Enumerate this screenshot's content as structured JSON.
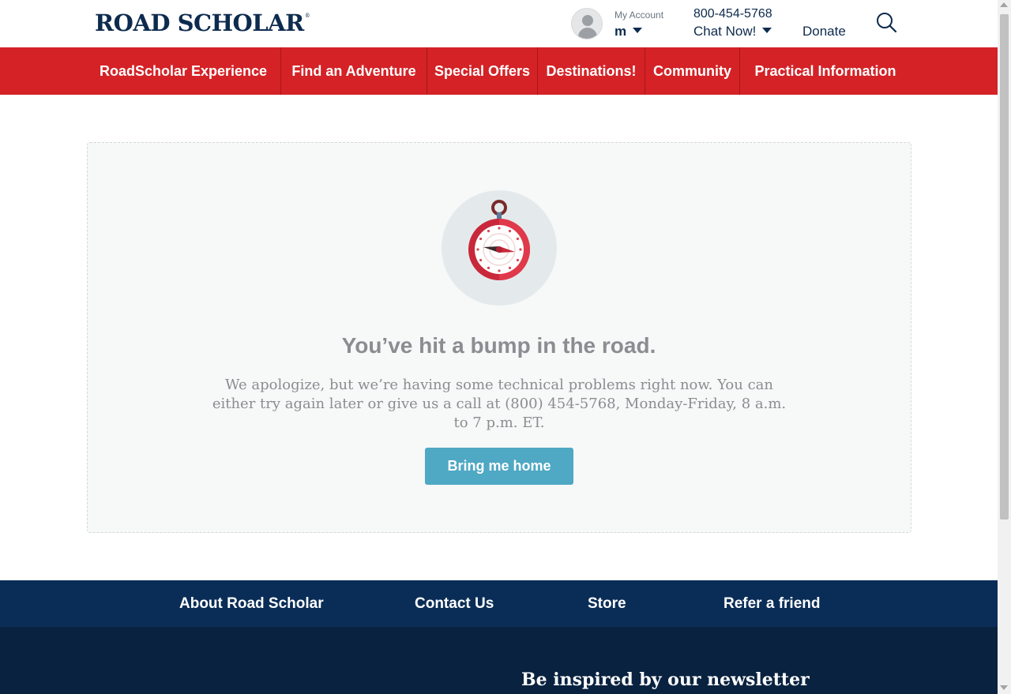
{
  "header": {
    "logo_text": "ROAD SCHOLAR",
    "logo_mark": "®",
    "account_label": "My Account",
    "account_name": "m",
    "phone": "800-454-5768",
    "chat_label": "Chat Now!",
    "donate_label": "Donate"
  },
  "nav": {
    "items": [
      {
        "label": "RoadScholar Experience"
      },
      {
        "label": "Find an Adventure"
      },
      {
        "label": "Special Offers"
      },
      {
        "label": "Destinations!"
      },
      {
        "label": "Community"
      },
      {
        "label": "Practical Information"
      }
    ]
  },
  "error": {
    "headline": "You’ve hit a bump in the road.",
    "message": "We apologize, but we’re having some technical problems right now. You can either try again later or give us a call at (800) 454-5768, Monday-Friday, 8 a.m. to 7 p.m. ET.",
    "button_label": "Bring me home"
  },
  "footer": {
    "links": [
      {
        "label": "About Road Scholar"
      },
      {
        "label": "Contact Us"
      },
      {
        "label": "Store"
      },
      {
        "label": "Refer a friend"
      }
    ],
    "newsletter_heading": "Be inspired by our newsletter"
  },
  "colors": {
    "brand_navy": "#0d2b4e",
    "nav_red": "#d42226",
    "button_blue": "#4fa8c4",
    "footer_navy": "#0a2d57"
  },
  "icons": [
    "person-icon",
    "chevron-down-icon",
    "search-icon",
    "compass-icon"
  ]
}
